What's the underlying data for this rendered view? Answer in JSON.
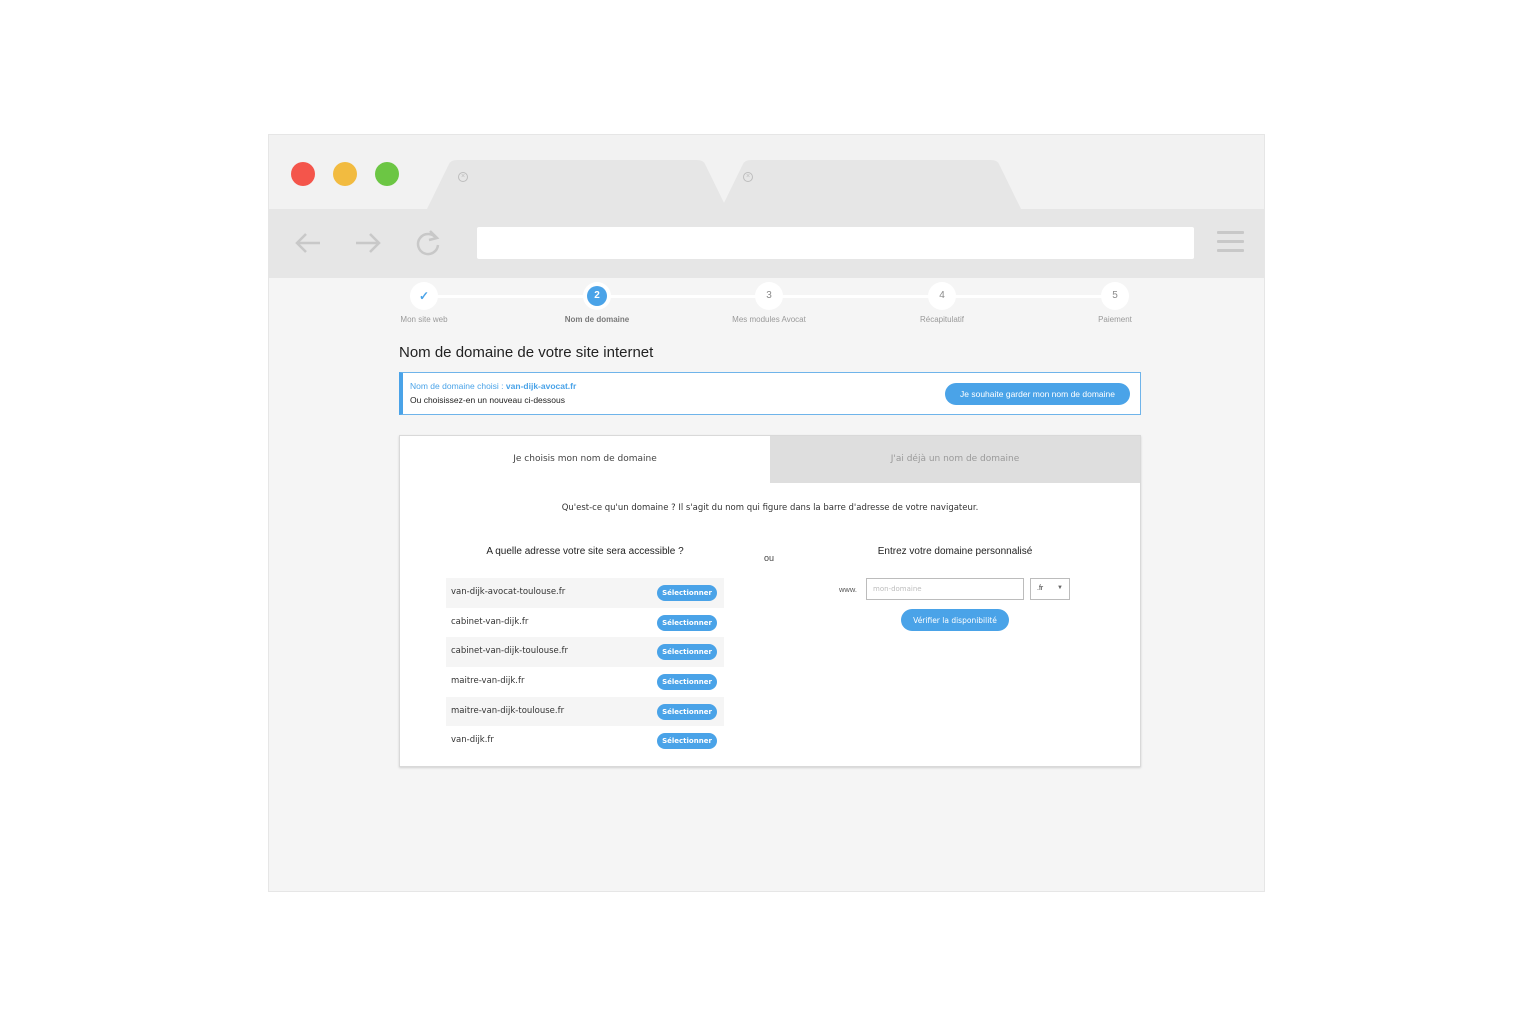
{
  "stepper": [
    {
      "number": "",
      "label": "Mon site web",
      "state": "done",
      "icon": "check-icon"
    },
    {
      "number": "2",
      "label": "Nom de domaine",
      "state": "active"
    },
    {
      "number": "3",
      "label": "Mes modules Avocat",
      "state": "todo"
    },
    {
      "number": "4",
      "label": "Récapitulatif",
      "state": "todo"
    },
    {
      "number": "5",
      "label": "Paiement",
      "state": "todo"
    }
  ],
  "page_title": "Nom de domaine de votre site internet",
  "notice": {
    "chosen_prefix": "Nom de domaine choisi : ",
    "chosen_domain": "van-dijk-avocat.fr",
    "subtext": "Ou choisissez-en un nouveau ci-dessous",
    "keep_button": "Je souhaite garder mon nom de domaine"
  },
  "tabs": {
    "choose": "Je choisis mon nom de domaine",
    "existing": "J'ai déjà un nom de domaine"
  },
  "explanation": "Qu'est-ce qu'un domaine ? Il s'agit du nom qui figure dans la barre d'adresse de votre navigateur.",
  "left_column": {
    "title": "A quelle adresse votre site sera accessible ?",
    "select_label": "Sélectionner",
    "domains": [
      "van-dijk-avocat-toulouse.fr",
      "cabinet-van-dijk.fr",
      "cabinet-van-dijk-toulouse.fr",
      "maitre-van-dijk.fr",
      "maitre-van-dijk-toulouse.fr",
      "van-dijk.fr"
    ]
  },
  "separator": "ou",
  "right_column": {
    "title": "Entrez votre domaine personnalisé",
    "www_prefix": "www.",
    "input_placeholder": "mon-domaine",
    "tld_value": ".fr",
    "verify_button": "Vérifier la disponibilité"
  },
  "colors": {
    "accent": "#4aa3e8",
    "traffic_red": "#f4554b",
    "traffic_yellow": "#f2bb40",
    "traffic_green": "#6cc644"
  }
}
